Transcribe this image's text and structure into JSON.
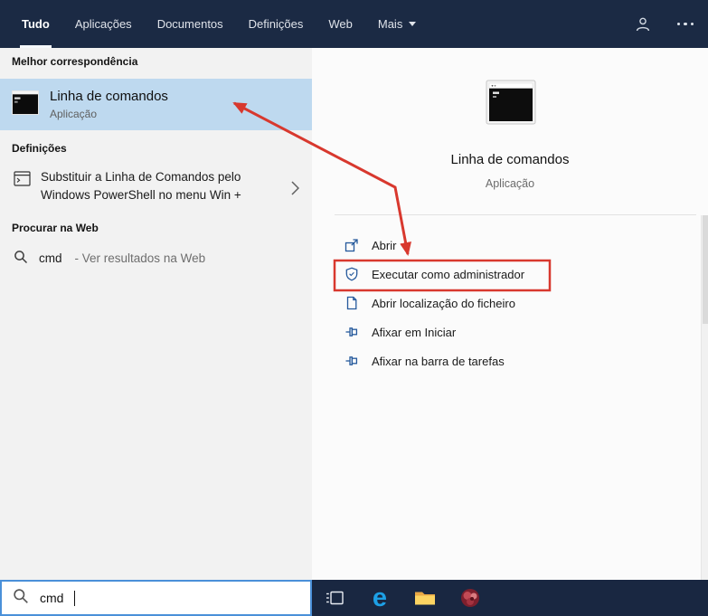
{
  "colors": {
    "topbar_navy": "#1b2a44",
    "taskbar_navy": "#192741",
    "left_panel_bg": "#f2f2f2",
    "right_panel_bg": "#fbfbfb",
    "selection_blue": "#bed9ef",
    "action_icon_blue": "#25599c",
    "annotation_red": "#d8382e",
    "search_box_border_blue": "#4a90d9",
    "edge_blue": "#1da0e6",
    "folder_yellow": "#fcd462"
  },
  "topbar": {
    "tabs": [
      {
        "label": "Tudo",
        "active": true
      },
      {
        "label": "Aplicações",
        "active": false
      },
      {
        "label": "Documentos",
        "active": false
      },
      {
        "label": "Definições",
        "active": false
      },
      {
        "label": "Web",
        "active": false
      },
      {
        "label": "Mais",
        "active": false,
        "has_dropdown": true
      }
    ],
    "icons": [
      "feedback-person-icon",
      "more-options-ellipsis-icon"
    ]
  },
  "left_panel": {
    "best_match_header": "Melhor correspondência",
    "best_match": {
      "title": "Linha de comandos",
      "subtitle": "Aplicação",
      "icon": "command-prompt-icon",
      "selected": true
    },
    "settings_header": "Definições",
    "settings_item": {
      "text": "Substituir a Linha de Comandos pelo Windows PowerShell no menu Win +",
      "icon": "command-prompt-outline-icon",
      "chevron": "chevron-right-icon"
    },
    "web_header": "Procurar na Web",
    "web_item": {
      "query": "cmd",
      "suffix": "- Ver resultados na Web",
      "icon": "search-icon"
    }
  },
  "preview": {
    "icon": "command-prompt-large-icon",
    "title": "Linha de comandos",
    "subtitle": "Aplicação",
    "actions": [
      {
        "label": "Abrir",
        "icon": "open-icon",
        "highlighted": false
      },
      {
        "label": "Executar como administrador",
        "icon": "shield-icon",
        "highlighted": true
      },
      {
        "label": "Abrir localização do ficheiro",
        "icon": "file-location-icon",
        "highlighted": false
      },
      {
        "label": "Afixar em Iniciar",
        "icon": "pin-icon",
        "highlighted": false
      },
      {
        "label": "Afixar na barra de tarefas",
        "icon": "pin-icon",
        "highlighted": false
      }
    ]
  },
  "search_box": {
    "value": "cmd",
    "icon": "search-icon"
  },
  "taskbar": {
    "icons": [
      "task-view-icon",
      "edge-icon",
      "file-explorer-icon",
      "app-icon"
    ]
  },
  "annotation": {
    "arrow_from": "best-match result",
    "arrow_to": "Executar como administrador",
    "box_around": "Executar como administrador"
  }
}
